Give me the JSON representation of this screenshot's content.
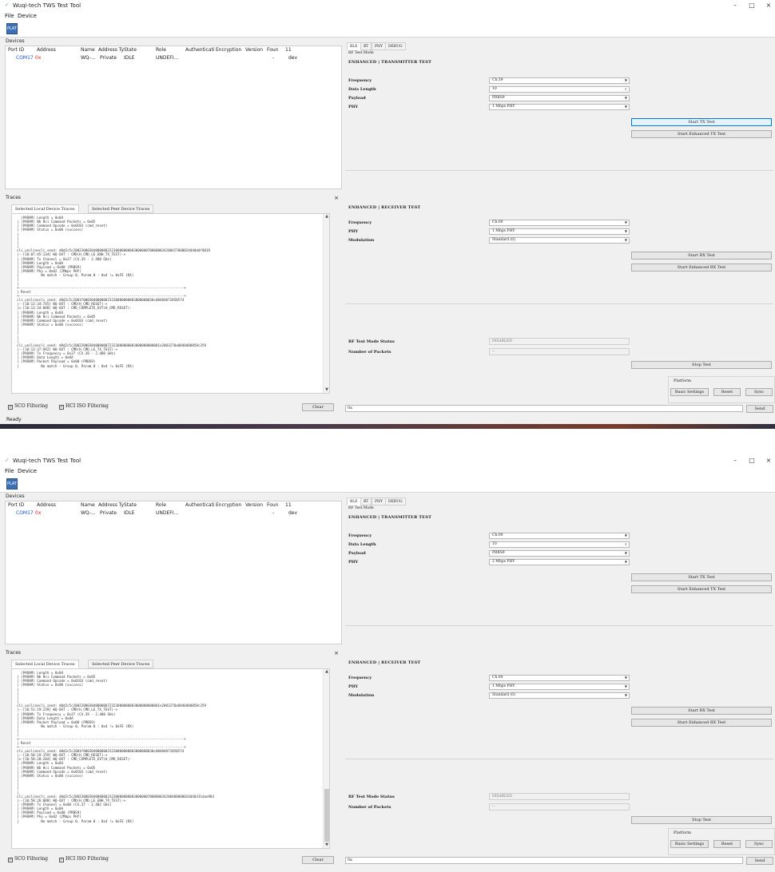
{
  "window": {
    "title": "Wuqi-tech TWS Test Tool",
    "app_icon": "check-icon",
    "minimize": "–",
    "maximize": "□",
    "close": "×"
  },
  "menu": {
    "file": "File",
    "device": "Device"
  },
  "toolbar": {
    "icon_label": "PLAT"
  },
  "devices": {
    "label": "Devices",
    "columns": [
      "Port ID",
      "Address",
      "Name",
      "Address Ty",
      "State",
      "Role",
      "Authenticati",
      "Encryption",
      "Version",
      "Foun",
      "11"
    ],
    "row": {
      "port": "COM17",
      "address": "0x",
      "name": "WQ-...",
      "addr_type": "Private",
      "state": "IDLE",
      "role": "UNDEFI...",
      "version": "-",
      "extra": "dev"
    }
  },
  "traces": {
    "label": "Traces",
    "tabs": [
      "Selected Local Device Traces",
      "Selected Peer Device Traces"
    ],
    "top_text": "  (PARAM) Length = 0x04\n| (PARAM) Nb Hci Command Packets = 0x05\n| (PARAM) Command Opcode = 0x0C03 (cmd_reset)\n| (PARAM) Status = 0x00 (success)\n|\n|\n|\n|\ncli_unilinecli_send: d0d2c5c2002300030400000023230000000003000000700000034200427000024040ddf0019\n|--[10:07:45:134] WQ-OUT : CMD(H_CMD_LE_ENH_TX_TEST)->\n| (PARAM) Tx Channel = 0x27 (Ch.39 - 2.480 GHz)\n| (PARAM) Length = 0x0A\n| (PARAM) Payload = 0x00 (PRBS9)\n| (PARAM) Phy = 0x02 (2Mbps PHY)\n|           No match - Group 0, Param 0 : 0x4 != 0xFE (RX)\n|\n|\n+----------------------------------------------------------------------------------+\n| Reset\n+----------------------------------------------------------------------------------+\ncli_unilinecli_send: d0d2c5c2001f00030400000023230000000003000000030c00404072850574\n|--[10:13:34:745] WQ-OUT : CMD(H_CMD_RESET)->\n|<-[10:13:34:888] WQ-OUT : CMD_COMPLETE_EVT(H_CMD_RESET)-\n| (PARAM) Length = 0x04\n| (PARAM) Nb Hci Command Packets = 0x05\n| (PARAM) Command Opcode = 0x0C03 (cmd_reset)\n| (PARAM) Status = 0x00 (success)\n|\n|\n|\n|\ncli_unilinecli_send: d0d2c5c2002200030400000072323000000003000000000001e2003270a0040400058c359\n|--[10:13:37:942] WQ-OUT : CMD(H_CMD_LE_TX_TEST)->\n| (PARAM) Tx Frequency = 0x27 (Ch.39 - 2.480 GHz)\n| (PARAM) Data Length = 0x0A\n| (PARAM) Packet Payload = 0x00 (PRBS9)\n|           No match - Group 0, Param 0 : 0x4 != 0xFE (RX)",
    "bottom_text": "  (PARAM) Length = 0x04\n| (PARAM) Nb Hci Command Packets = 0x05\n| (PARAM) Command Opcode = 0x0C03 (cmd_reset)\n| (PARAM) Status = 0x00 (success)\n|\n|\n|\n|\ncli_unilinecli_send: d0d2c5c2002200030400000072323000000003000000000001e2003270a0040400058c359\n|--[10:51:19:239] WQ-OUT : CMD(H_CMD_LE_TX_TEST)->\n| (PARAM) Tx Frequency = 0x27 (Ch.39 - 2.480 GHz)\n| (PARAM) Data Length = 0x0A\n| (PARAM) Packet Payload = 0x00 (PRBS9)\n|           No match - Group 0, Param 0 : 0x4 != 0xFE (RX)\n|\n|\n+----------------------------------------------------------------------------------+\n| Reset\n+----------------------------------------------------------------------------------+\ncli_unilinecli_send: d0d2c5c2001f00030400000023230000000003000000030c00404072850574\n|--[10:58:19:159] WQ-OUT : CMD(H_CMD_RESET)->\n|<-[10:58:20:204] WQ-OUT : CMD_COMPLETE_EVT(H_CMD_RESET)-\n| (PARAM) Length = 0x04\n| (PARAM) Nb Hci Command Packets = 0x05\n| (PARAM) Command Opcode = 0x0C03 (cmd_reset)\n| (PARAM) Status = 0x00 (success)\n|\n|\n|\n|\ncli_unilinecli_send: d0d2c5c2002300030400000023230000000003000000700000034200400000024040331dae983\n|--[10:58:26:888] WQ-OUT : CMD(H_CMD_LE_ENH_TX_TEST)->\n| (PARAM) Tx Channel = 0x00 (Ch.37 - 2.402 GHz)\n| (PARAM) Length = 0x0A\n| (PARAM) Payload = 0x00 (PRBS9)\n| (PARAM) Phy = 0x02 (2Mbps PHY)\n|           No match - Group 0, Param 0 : 0x4 != 0xFE (RX)"
  },
  "filters": {
    "sco": "SCO Filtering",
    "hci": "HCI ISO Filtering",
    "clear": "Clear"
  },
  "status": "Ready",
  "right": {
    "tabs": [
      "BLE",
      "BT",
      "PHY",
      "DEBUG"
    ],
    "mode": "RF Test Mode",
    "tx_title": "ENHANCED | TRANSMITTER TEST",
    "rx_title": "ENHANCED | RECEIVER TEST",
    "labels": {
      "frequency": "Frequency",
      "data_length": "Data Length",
      "payload": "Payload",
      "phy": "PHY",
      "modulation": "Modulation",
      "rf_status": "RF Test Mode Status",
      "num_packets": "Number of Packets"
    },
    "buttons": {
      "start_tx": "Start TX Test",
      "start_enh_tx": "Start Enhanced TX Test",
      "start_rx": "Start RX Test",
      "start_enh_rx": "Start Enhanced RX Test",
      "stop": "Stop Test",
      "basic": "Basic Settings",
      "reset": "Reset",
      "sync": "Sync",
      "send": "Send"
    },
    "platform": "Platform",
    "rf_status_value": "DISABLED",
    "num_packets_value": "--",
    "cmd_value": "0x"
  },
  "top": {
    "tx_frequency": "Ch.39",
    "data_length": "10",
    "payload": "PRBS9",
    "tx_phy": "1 Mbps PHY",
    "rx_frequency": "Ch.00",
    "rx_phy": "1 Mbps PHY",
    "modulation": "Standard (0)"
  },
  "bottom": {
    "tx_frequency": "Ch.00",
    "data_length": "10",
    "payload": "PRBS9",
    "tx_phy": "2 Mbps PHY",
    "rx_frequency": "Ch.00",
    "rx_phy": "1 Mbps PHY",
    "modulation": "Standard (0)"
  }
}
